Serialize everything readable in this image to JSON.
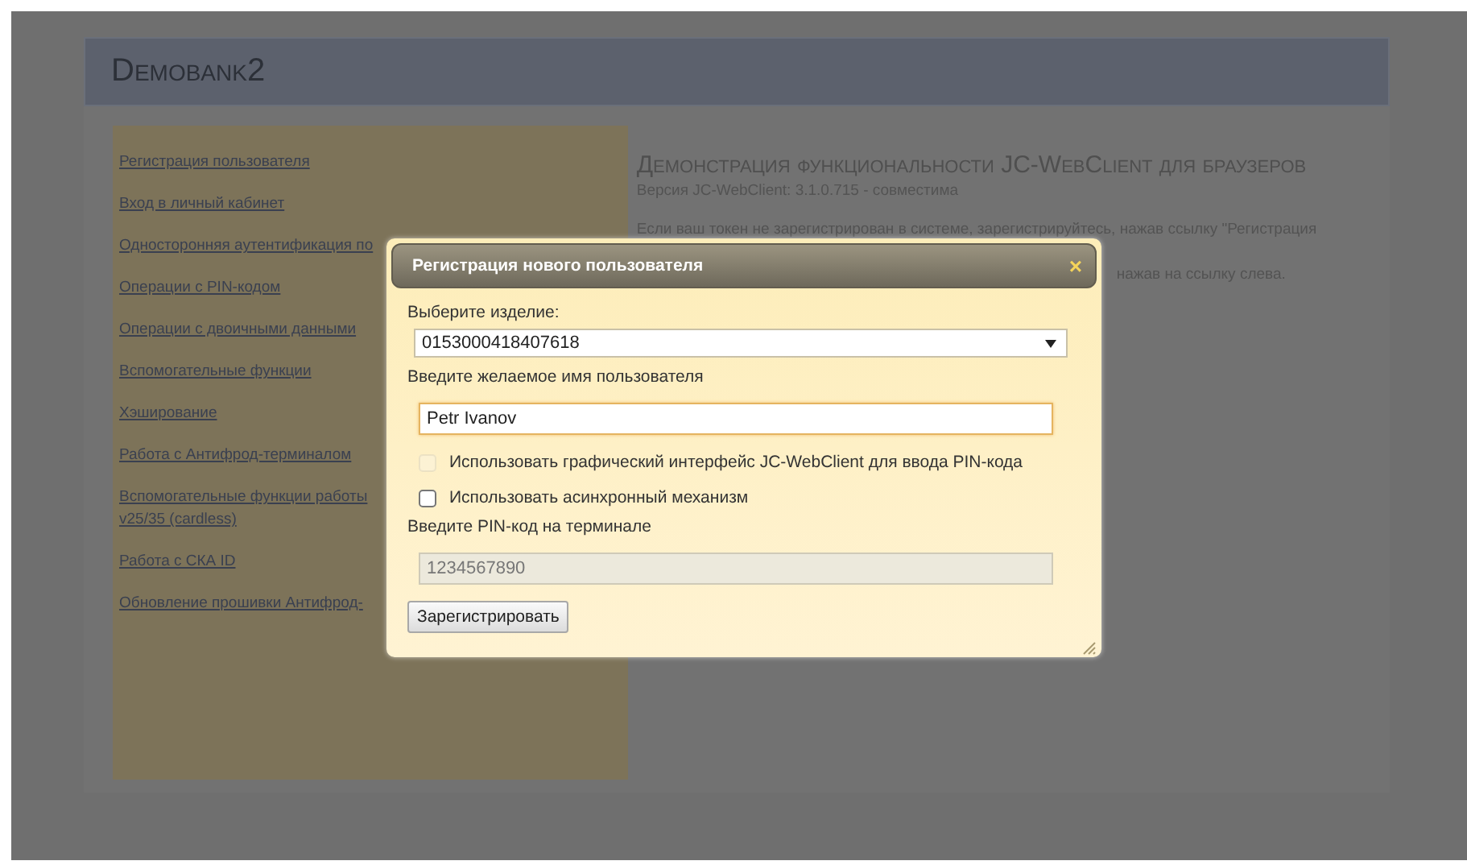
{
  "site": {
    "logo": "Demobank2"
  },
  "sidebar": {
    "items": [
      {
        "label": "Регистрация пользователя"
      },
      {
        "label": "Вход в личный кабинет"
      },
      {
        "label": "Односторонняя аутентификация по"
      },
      {
        "label": "Операции с PIN-кодом"
      },
      {
        "label": "Операции с двоичными данными"
      },
      {
        "label": "Вспомогательные функции"
      },
      {
        "label": "Хэширование"
      },
      {
        "label": "Работа с Антифрод-терминалом"
      },
      {
        "label": "Вспомогательные функции работы v25/35 (cardless)"
      },
      {
        "label": "Работа с СКА ID"
      },
      {
        "label": "Обновление прошивки Антифрод-"
      }
    ]
  },
  "main": {
    "heading": "Демонстрация функциональности JC-WebClient для браузеров",
    "version": "Версия JC-WebClient: 3.1.0.715 - совместима",
    "paragraph": "Если ваш токен не зарегистрирован в системе, зарегистрируйтесь, нажав ссылку \"Регистрация",
    "paragraph_tail": "нажав на ссылку слева."
  },
  "dialog": {
    "title": "Регистрация нового пользователя",
    "close": "×",
    "device_label": "Выберите изделие:",
    "device_value": "0153000418407618",
    "name_label": "Введите желаемое имя пользователя",
    "name_value": "Petr Ivanov",
    "options": [
      {
        "label": "Использовать графический интерфейс JC-WebClient для ввода PIN-кода",
        "checked": false,
        "disabled": true
      },
      {
        "label": "Использовать асинхронный механизм",
        "checked": false,
        "disabled": false
      }
    ],
    "pin_label": "Введите PIN-код на терминале",
    "pin_value": "1234567890",
    "pin_disabled": true,
    "submit": "Зарегистрировать"
  }
}
